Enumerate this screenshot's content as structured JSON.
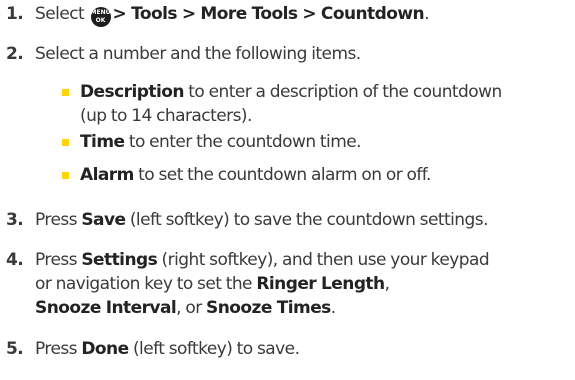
{
  "steps": [
    {
      "number": "1.",
      "pre": "Select ",
      "icon": {
        "name": "menu-ok-icon",
        "top": "MENU",
        "bottom": "OK"
      },
      "path": "> Tools > More Tools > Countdown",
      "post": "."
    },
    {
      "number": "2.",
      "text": "Select a number and the following items.",
      "bullets": [
        {
          "label": "Description",
          "text": " to enter a description of the countdown",
          "cont": "(up to 14 characters)."
        },
        {
          "label": "Time",
          "text": " to enter the countdown time."
        },
        {
          "label": "Alarm",
          "text": " to set the countdown alarm on or off."
        }
      ]
    },
    {
      "number": "3.",
      "pre": "Press ",
      "key": "Save",
      "post": " (left softkey) to save the countdown settings."
    },
    {
      "number": "4.",
      "pre": "Press ",
      "key": "Settings",
      "post": " (right softkey), and then use your keypad",
      "line2": "or navigation key to set the ",
      "opt1": "Ringer Length",
      "comma1": ",",
      "opt2": "Snooze Interval",
      "or": ", or ",
      "opt3": "Snooze Times",
      "end": "."
    },
    {
      "number": "5.",
      "pre": "Press ",
      "key": "Done",
      "post": " (left softkey) to save."
    }
  ],
  "colors": {
    "text": "#3a3a3a",
    "bold": "#232323",
    "bullet": "#ffd400",
    "icon_bg": "#1c1c1c"
  }
}
